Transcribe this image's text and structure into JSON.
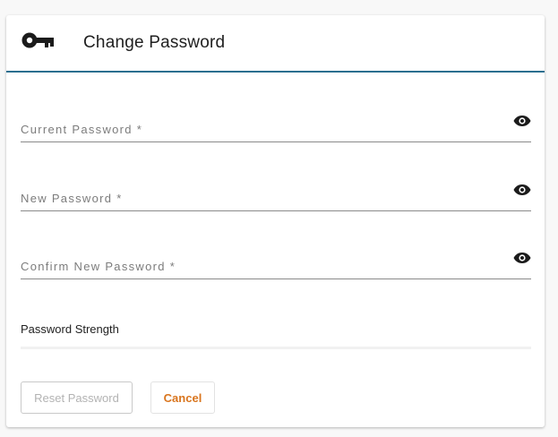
{
  "dialog": {
    "title": "Change Password",
    "icon": "key-icon"
  },
  "fields": [
    {
      "label": "Current Password *",
      "value": "",
      "visibility_icon": "eye-icon"
    },
    {
      "label": "New Password *",
      "value": "",
      "visibility_icon": "eye-icon"
    },
    {
      "label": "Confirm New Password *",
      "value": "",
      "visibility_icon": "eye-icon"
    }
  ],
  "strength": {
    "label": "Password Strength",
    "level": 0
  },
  "actions": {
    "reset_label": "Reset Password",
    "reset_enabled": false,
    "cancel_label": "Cancel"
  },
  "colors": {
    "header_divider": "#2b6f8f",
    "cancel_text": "#d9751e",
    "disabled_text": "#b3b3b3"
  }
}
